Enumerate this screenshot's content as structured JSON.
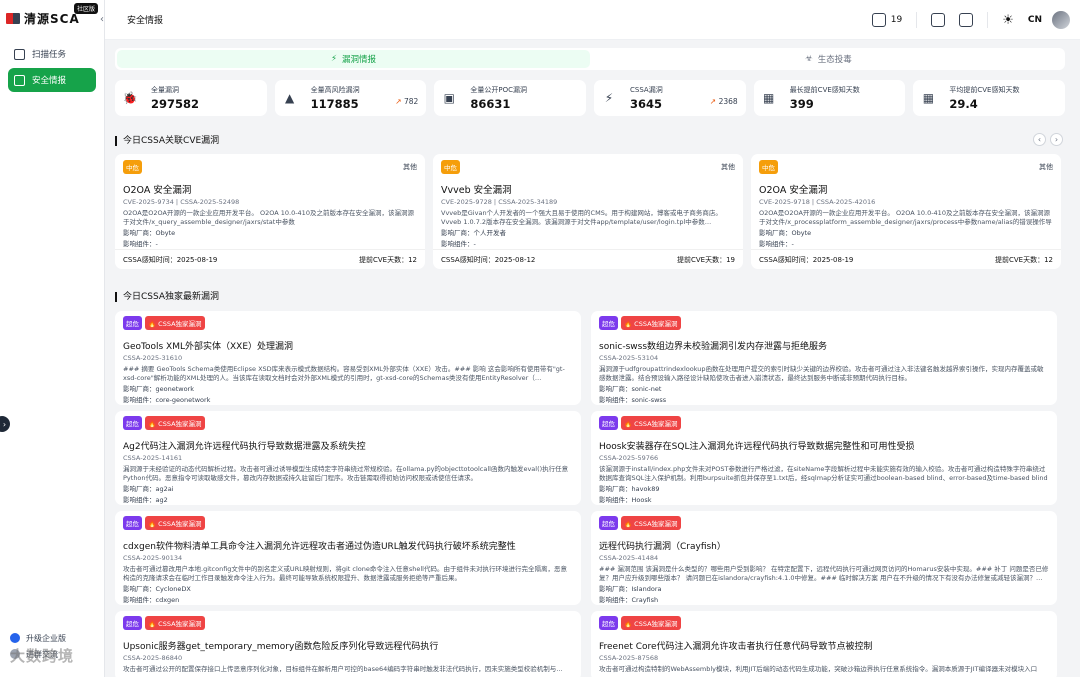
{
  "app": {
    "name": "清源SCA",
    "badge": "社区版"
  },
  "sidebar": {
    "items": [
      {
        "label": "扫描任务",
        "icon": "scan-task-icon"
      },
      {
        "label": "安全情报",
        "icon": "security-intel-icon"
      }
    ],
    "bottom": [
      {
        "label": "升级企业版"
      },
      {
        "label": "进群交流"
      }
    ],
    "watermark": "大数跨境"
  },
  "header": {
    "breadcrumb": "安全情报",
    "notify_count": "19",
    "lang": "CN"
  },
  "tabs": [
    {
      "label": "漏洞情报",
      "active": true
    },
    {
      "label": "生态投毒",
      "active": false
    }
  ],
  "stats": [
    {
      "label": "全量漏洞",
      "value": "297582",
      "trend": "",
      "icon": "bug-icon"
    },
    {
      "label": "全量高风险漏洞",
      "value": "117885",
      "trend": "782",
      "icon": "warning-icon"
    },
    {
      "label": "全量公开POC漏洞",
      "value": "86631",
      "trend": "",
      "icon": "poc-icon"
    },
    {
      "label": "CSSA漏洞",
      "value": "3645",
      "trend": "2368",
      "icon": "bolt-icon"
    },
    {
      "label": "最长提前CVE感知天数",
      "value": "399",
      "trend": "",
      "icon": "calendar-icon"
    },
    {
      "label": "平均提前CVE感知天数",
      "value": "29.4",
      "trend": "",
      "icon": "calendar-clock-icon"
    }
  ],
  "section1": {
    "title": "今日CSSA关联CVE漏洞"
  },
  "cve_cards": [
    {
      "level": "中危",
      "type": "其他",
      "title": "O2OA 安全漏洞",
      "ids": "CVE-2025-9734 | CSSA-2025-52498",
      "desc": "O2OA是O2OA开源的一款企业应用开发平台。 O2OA 10.0-410及之前版本存在安全漏洞，该漏洞源于对文件/x_query_assemble_designer/jaxrs/stat中参数name/alias/description/applicationName的…",
      "vendor": "影响厂商：Obyte",
      "component": "影响组件：-",
      "sensed": "CSSA感知时间：2025-08-19",
      "ahead": "提前CVE天数：12"
    },
    {
      "level": "中危",
      "type": "其他",
      "title": "Vvveb 安全漏洞",
      "ids": "CVE-2025-9728 | CSSA-2025-34189",
      "desc": "Vvveb是Givan个人开发者的一个强大且易于使用的CMS。用于构建网站，博客或电子商务商店。 Vvveb 1.0.7.2版本存在安全漏洞。该漏洞源于对文件app/template/user/login.tpl中参数…",
      "vendor": "影响厂商：个人开发者",
      "component": "影响组件：-",
      "sensed": "CSSA感知时间：2025-08-12",
      "ahead": "提前CVE天数：19"
    },
    {
      "level": "中危",
      "type": "其他",
      "title": "O2OA 安全漏洞",
      "ids": "CVE-2025-9718 | CSSA-2025-42016",
      "desc": "O2OA是O2OA开源的一款企业应用开发平台。 O2OA 10.0-410及之前版本存在安全漏洞，该漏洞源于对文件/x_processplatform_assemble_designer/jaxrs/process中参数name/alias的错误操作导致跨…",
      "vendor": "影响厂商：Obyte",
      "component": "影响组件：-",
      "sensed": "CSSA感知时间：2025-08-19",
      "ahead": "提前CVE天数：12"
    }
  ],
  "section2": {
    "title": "今日CSSA独家最新漏洞"
  },
  "exclusive_cards": [
    {
      "level": "超危",
      "tag": "CSSA独家漏洞",
      "title": "GeoTools XML外部实体（XXE）处理漏洞",
      "id": "CSSA-2025-31610",
      "desc": "### 摘要 GeoTools Schema类使用Eclipse XSD库来表示模式数据结构。容易受到XML外部实体（XXE）攻击。### 影响 这会影响所有使用带有\"gt-xsd-core\"解析功能的XML处理的人。当该库在读取文档时会对外部XML模式的引用时，gt-xsd-core的Schemas类没有使用EntityResolver（…",
      "vendor": "影响厂商：geonetwork",
      "component": "影响组件：core-geonetwork"
    },
    {
      "level": "超危",
      "tag": "CSSA独家漏洞",
      "title": "sonic-swss数组边界未校验漏洞引发内存泄露与拒绝服务",
      "id": "CSSA-2025-53104",
      "desc": "漏洞源于udfgroupattrindexlookup函数在处理用户提交的索引时缺少关键的边界校验。攻击者可通过注入非法键名触发越界索引操作，实现内存覆盖或敏感数据泄露。结合预设输入路径设计缺陷使攻击者进入崩溃状态，最终达到服务中断或非预期代码执行目标。",
      "vendor": "影响厂商：sonic-net",
      "component": "影响组件：sonic-swss"
    },
    {
      "level": "超危",
      "tag": "CSSA独家漏洞",
      "title": "Ag2代码注入漏洞允许远程代码执行导致数据泄露及系统失控",
      "id": "CSSA-2025-14161",
      "desc": "漏洞源于未经验证的动态代码解析过程。攻击者可通过诱导模型生成特定字符串绕过常规校验。在ollama.py的objecttotoolcall函数内触发eval()执行任意Python代码。恶意指令可读取敏感文件，篡改内存数据或持久驻留后门程序。攻击链需取得初始访问权限或诱使信任请求。",
      "vendor": "影响厂商：ag2ai",
      "component": "影响组件：ag2"
    },
    {
      "level": "超危",
      "tag": "CSSA独家漏洞",
      "title": "Hoosk安装器存在SQL注入漏洞允许远程代码执行导致数据完整性和可用性受损",
      "id": "CSSA-2025-59766",
      "desc": "该漏洞源于install/index.php文件未对POST参数进行严格过滤，在siteName字段解析过程中未能实施有效的输入校验。攻击者可通过构造特殊字符串绕过数据库查询SQL注入保护机制。利用burpsuite抓包并保存至1.txt后，经sqlmap分析证实可通过boolean-based blind、error-based及time-based blind三种模式突破…",
      "vendor": "影响厂商：havok89",
      "component": "影响组件：Hoosk"
    },
    {
      "level": "超危",
      "tag": "CSSA独家漏洞",
      "title": "cdxgen软件物料清单工具命令注入漏洞允许远程攻击者通过伪造URL触发代码执行破坏系统完整性",
      "id": "CSSA-2025-90134",
      "desc": "攻击者可通过篡改用户本地.gitconfig文件中的别名定义或URL映射规则，将git clone命令注入任意shell代码。由于组件未对执行环境进行完全隔离，恶意构造的克隆请求会在临时工作目录触发命令注入行为。最终可能导致系统权限提升、数据泄露或服务拒绝等严重后果。",
      "vendor": "影响厂商：CycloneDX",
      "component": "影响组件：cdxgen"
    },
    {
      "level": "超危",
      "tag": "CSSA独家漏洞",
      "title": "远程代码执行漏洞（Crayfish）",
      "id": "CSSA-2025-41484",
      "desc": "### 漏洞范围 该漏洞是什么类型的？哪些用户受到影响？ 在特定配置下，远程代码执行可通过网页访问的Homarus安装中实现。### 补丁 问题是否已修复？用户应升级到哪些版本？ 请问题已在islandora/crayfish:4.1.0中修复。### 临时解决方案 用户在不升级的情况下有没有办法修复或减轻该漏洞？…",
      "vendor": "影响厂商：Islandora",
      "component": "影响组件：Crayfish"
    },
    {
      "level": "超危",
      "tag": "CSSA独家漏洞",
      "title": "Upsonic服务器get_temporary_memory函数危险反序列化导致远程代码执行",
      "id": "CSSA-2025-86840",
      "desc": "攻击者可通过公开的配置保存接口上传恶意序列化对象，目标组件在解析用户可控的base64编码字符串时触发非法代码执行，因未实施类型校验机制与…",
      "vendor": "",
      "component": ""
    },
    {
      "level": "超危",
      "tag": "CSSA独家漏洞",
      "title": "Freenet Core代码注入漏洞允许攻击者执行任意代码导致节点被控制",
      "id": "CSSA-2025-87568",
      "desc": "攻击者可通过构造特制的WebAssembly模块，利用JIT后端的动态代码生成功能，突破沙箱边界执行任意系统指令。漏洞本质源于JIT编译器未对模块入口进…",
      "vendor": "",
      "component": ""
    }
  ]
}
